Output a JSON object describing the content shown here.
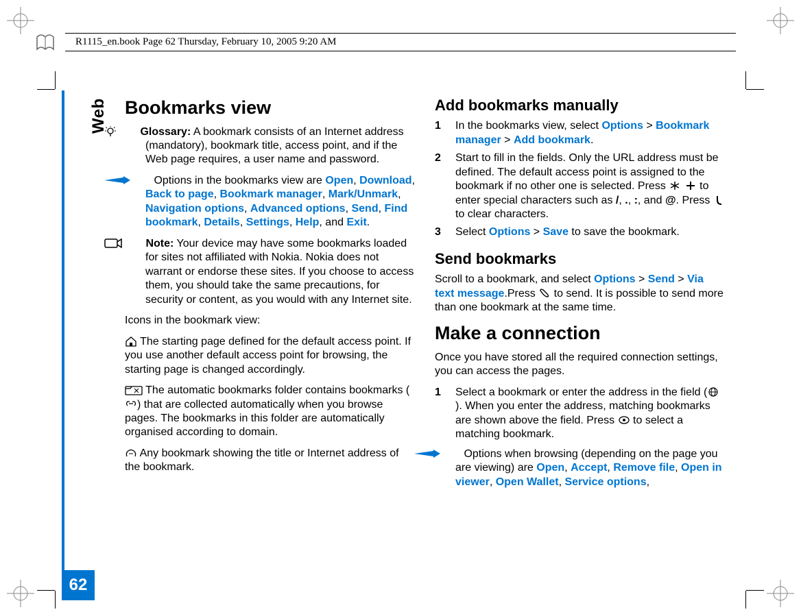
{
  "runhead": "R1115_en.book  Page 62  Thursday, February 10, 2005  9:20 AM",
  "side_label": "Web",
  "page_number": "62",
  "h1_bookmarks": "Bookmarks view",
  "gloss_label": "Glossary:",
  "gloss_body": " A bookmark consists of an Internet address (mandatory), bookmark title, access point, and if the Web page requires, a user name and password.",
  "opts_prefix": " Options in the bookmarks view are ",
  "opt_open": "Open",
  "opt_download": "Download",
  "opt_back": "Back to page",
  "opt_bmgr": "Bookmark manager",
  "opt_mark": "Mark/Unmark",
  "opt_nav": "Navigation options",
  "opt_adv": "Advanced options",
  "opt_send": "Send",
  "opt_find": "Find bookmark",
  "opt_details": "Details",
  "opt_settings": "Settings",
  "opt_help": "Help",
  "opt_exit": "Exit",
  "note_label": "Note:",
  "note_body": " Your device may have some bookmarks loaded for sites not affiliated with Nokia. Nokia does not warrant or endorse these sites. If you choose to access them, you should take the same precautions, for security or content, as you would with any Internet site.",
  "icons_heading": "Icons in the bookmark view:",
  "icon1_body": " The starting page defined for the default access point. If you use another default access point for browsing, the starting page is changed accordingly.",
  "icon2_body_a": " The automatic bookmarks folder contains bookmarks (",
  "icon2_body_b": ") that are collected automatically when you browse pages. The bookmarks in this folder are automatically organised according to domain.",
  "icon3_body": " Any bookmark showing the title or Internet address of the bookmark.",
  "h2_add": "Add bookmarks manually",
  "add1_a": "In the bookmarks view, select ",
  "opt_options": "Options",
  "gt": " > ",
  "opt_bmgr2": "Bookmark manager",
  "opt_addbm": "Add bookmark",
  "add2_a": "Start to fill in the fields. Only the URL address must be defined. The default access point is assigned to the bookmark if no other one is selected. Press ",
  "add2_b": " to enter special characters such as ",
  "sc_slash": "/",
  "sc_dot": ".",
  "sc_colon": ":",
  "sc_and": ", and ",
  "sc_at": "@",
  "add2_c": ". Press ",
  "add2_d": " to clear characters.",
  "add3_a": "Select ",
  "opt_save": "Save",
  "add3_b": " to save the bookmark.",
  "h2_send": "Send bookmarks",
  "send_a": "Scroll to a bookmark, and select ",
  "opt_send2": "Send",
  "opt_via": "Via text message",
  "send_b": ".Press ",
  "send_c": " to send. It is possible to send more than one bookmark at the same time.",
  "h1_make": "Make a connection",
  "make_p": "Once you have stored all the required connection settings, you can access the pages.",
  "mk1_a": "Select a bookmark or enter the address in the field (",
  "mk1_b": "). When you enter the address, matching bookmarks are shown above the field. Press ",
  "mk1_c": " to select a matching bookmark.",
  "mk_opts_prefix": " Options when browsing (depending on the page you are viewing) are ",
  "mopt_open": "Open",
  "mopt_accept": "Accept",
  "mopt_remove": "Remove file",
  "mopt_viewer": "Open in viewer",
  "mopt_wallet": "Open Wallet",
  "mopt_service": "Service options",
  "comma": ", ",
  "and_word": ", and ",
  "period": "."
}
